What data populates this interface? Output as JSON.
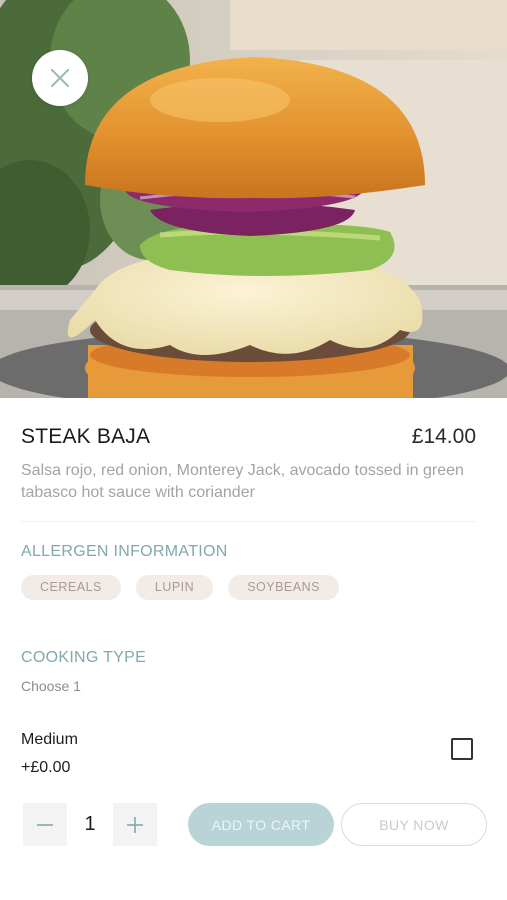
{
  "product": {
    "name": "STEAK BAJA",
    "price": "£14.00",
    "description": "Salsa rojo, red onion, Monterey Jack, avocado tossed in green tabasco hot sauce with coriander"
  },
  "allergens": {
    "heading": "ALLERGEN INFORMATION",
    "items": [
      "CEREALS",
      "LUPIN",
      "SOYBEANS"
    ]
  },
  "cooking": {
    "heading": "COOKING TYPE",
    "hint": "Choose 1",
    "option": {
      "name": "Medium",
      "price": "+£0.00",
      "checked": false
    }
  },
  "cart": {
    "quantity": "1",
    "add_label": "ADD TO CART",
    "buy_label": "BUY NOW"
  },
  "icons": {
    "close": "close-icon",
    "minus": "minus-icon",
    "plus": "plus-icon"
  },
  "colors": {
    "accent": "#7fa9ab",
    "add_button_bg": "#b9d4d6",
    "chip_bg": "#f2ebe6"
  }
}
